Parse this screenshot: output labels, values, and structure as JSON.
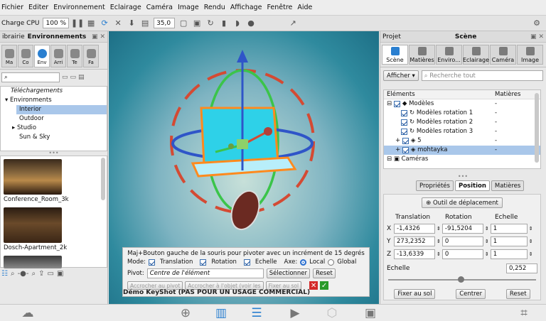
{
  "menu": [
    "Fichier",
    "Editer",
    "Environnement",
    "Eclairage",
    "Caméra",
    "Image",
    "Rendu",
    "Affichage",
    "Fenêtre",
    "Aide"
  ],
  "toolbar": {
    "cpu_label": "Charge CPU",
    "cpu_value": "100 %",
    "field_value": "35,0"
  },
  "left": {
    "header_prefix": "ibrairie",
    "header_title": "Environnements",
    "tabs": [
      "Ma",
      "Co",
      "Env",
      "Arri",
      "Te",
      "Fa"
    ],
    "tree": [
      "Téléchargements",
      "Environments",
      "Interior",
      "Outdoor",
      "Studio",
      "Sun & Sky"
    ],
    "thumbs": [
      "Conference_Room_3k",
      "Dosch-Apartment_2k"
    ]
  },
  "right": {
    "header_left": "Projet",
    "header_title": "Scène",
    "tabs": [
      "Scène",
      "Matières",
      "Enviro...",
      "Eclairage",
      "Caméra",
      "Image"
    ],
    "show_label": "Afficher",
    "search_placeholder": "Recherche tout",
    "col_elements": "Eléments",
    "col_matieres": "Matières",
    "rows": [
      {
        "label": "Modèles",
        "value": "-"
      },
      {
        "label": "Modèles rotation 1",
        "value": "-"
      },
      {
        "label": "Modèles rotation 2",
        "value": "-"
      },
      {
        "label": "Modèles rotation 3",
        "value": "-"
      },
      {
        "label": "5",
        "value": "-"
      },
      {
        "label": "mohtayka",
        "value": "-"
      },
      {
        "label": "Caméras",
        "value": ""
      }
    ],
    "subtabs": [
      "Propriétés",
      "Position",
      "Matières"
    ],
    "tool_btn": "Outil de déplacement",
    "col_translation": "Translation",
    "col_rotation": "Rotation",
    "col_echelle": "Echelle",
    "axes": [
      {
        "axis": "X",
        "t": "-1,4326",
        "r": "-91,5204",
        "e": "1"
      },
      {
        "axis": "Y",
        "t": "273,2352",
        "r": "0",
        "e": "1"
      },
      {
        "axis": "Z",
        "t": "-13,6339",
        "r": "0",
        "e": "1"
      }
    ],
    "scale_label": "Echelle",
    "scale_value": "0,252",
    "bottom_btns": [
      "Fixer au sol",
      "Centrer",
      "Reset"
    ]
  },
  "mode_panel": {
    "hint": "Maj+Bouton gauche de la souris pour pivoter avec un incrément de 15 degrés",
    "mode_label": "Mode:",
    "translation": "Translation",
    "rotation": "Rotation",
    "echelle": "Echelle",
    "axe_label": "Axe:",
    "local": "Local",
    "global": "Global",
    "pivot_label": "Pivot:",
    "pivot_value": "Centre de l'élément",
    "select_btn": "Sélectionner",
    "reset_btn": "Reset",
    "btn_a": "Accrocher au pivot",
    "btn_b": "Accrocher à l'objet (voir les",
    "btn_c": "Fixer au sol",
    "demo": "Démo KeyShot (PAS POUR UN USAGE COMMERCIAL)"
  }
}
